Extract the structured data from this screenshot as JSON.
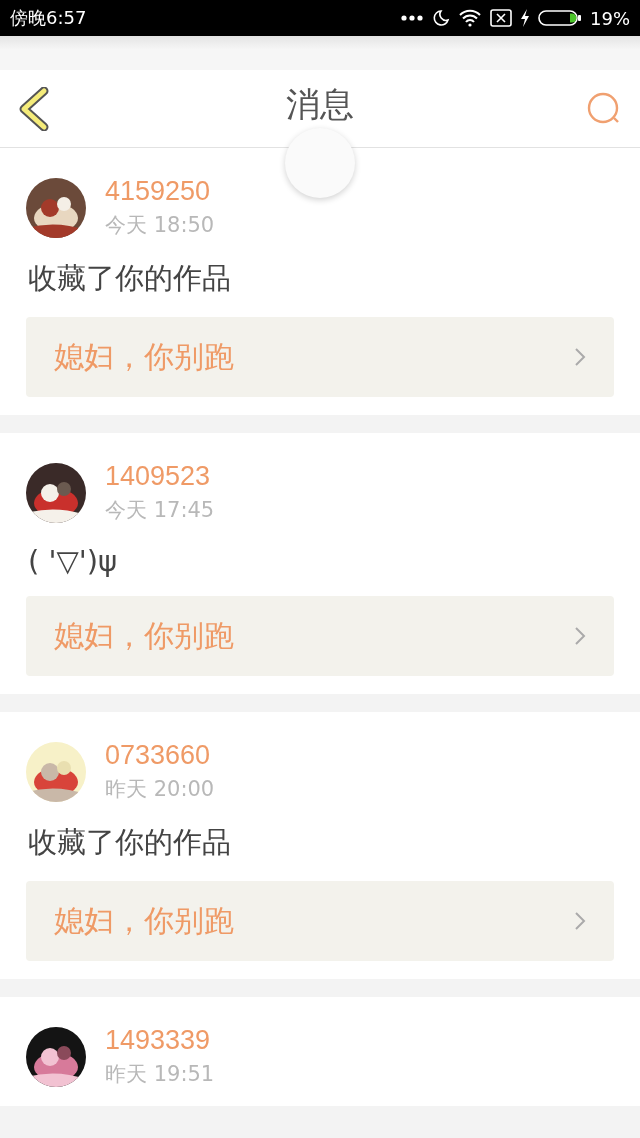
{
  "status_bar": {
    "time": "傍晚6:57",
    "battery": "19%"
  },
  "header": {
    "title": "消息"
  },
  "messages": [
    {
      "user": "4159250",
      "time": "今天 18:50",
      "text": "收藏了你的作品",
      "work": "媳妇，你别跑"
    },
    {
      "user": "1409523",
      "time": "今天 17:45",
      "text": "( '▽')ψ",
      "work": "媳妇，你别跑"
    },
    {
      "user": "0733660",
      "time": "昨天 20:00",
      "text": "收藏了你的作品",
      "work": "媳妇，你别跑"
    },
    {
      "user": "1493339",
      "time": "昨天 19:51"
    }
  ]
}
